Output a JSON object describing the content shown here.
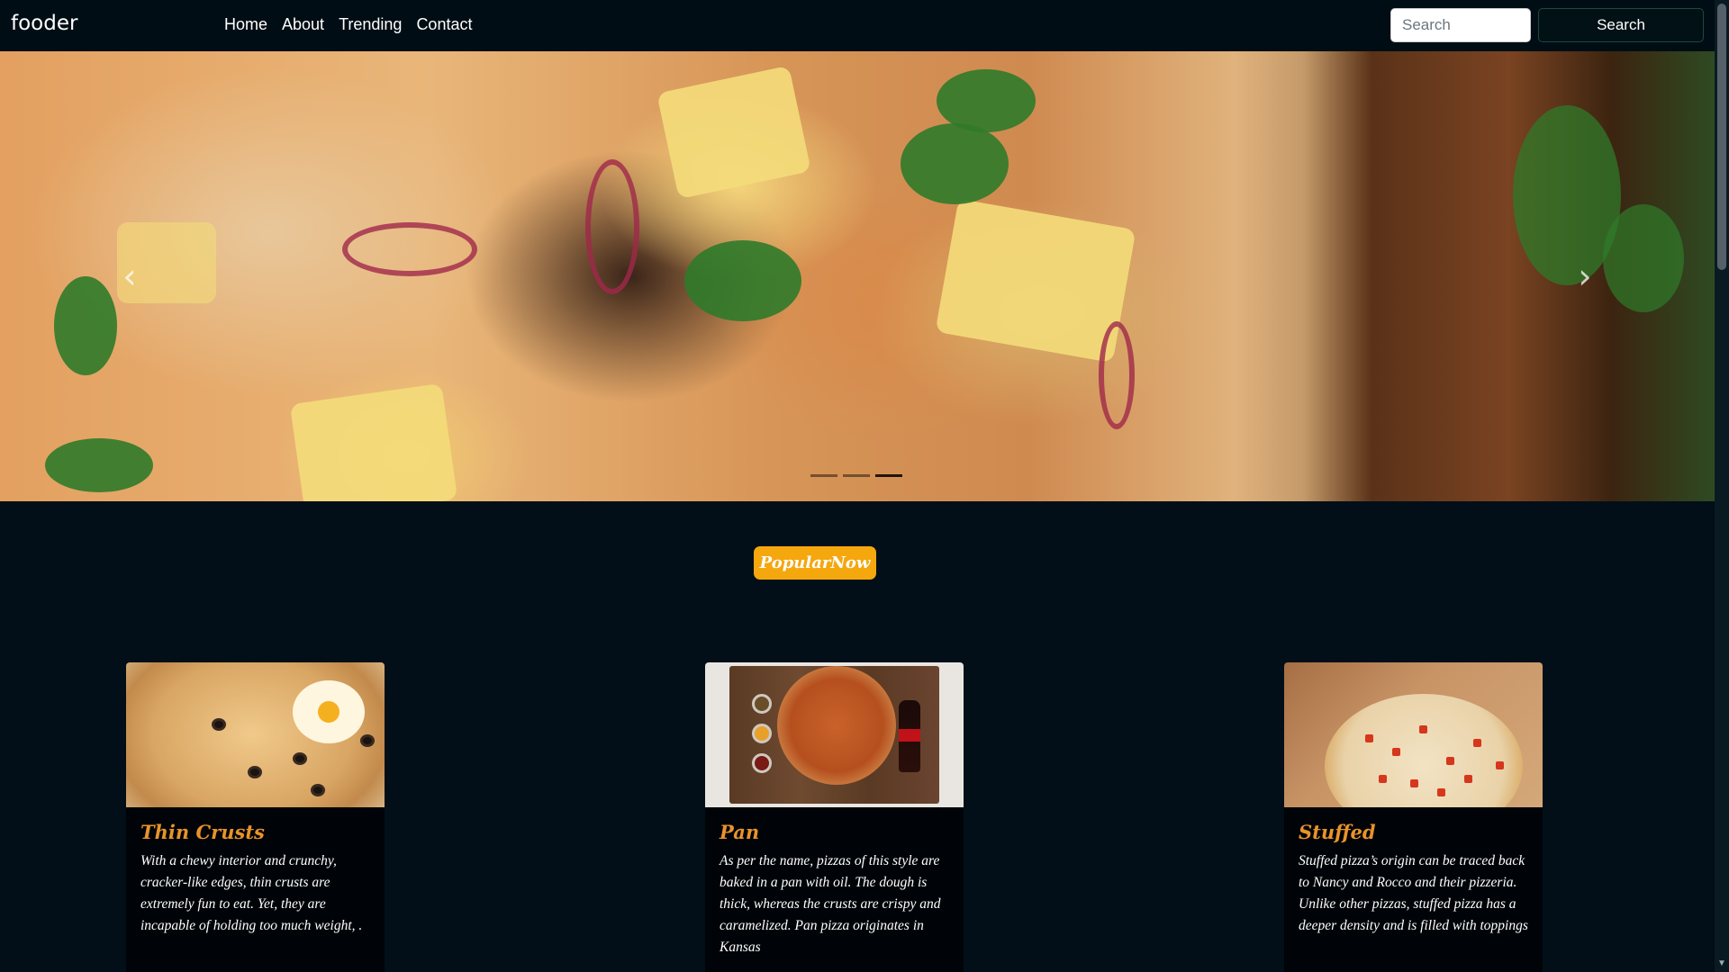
{
  "nav": {
    "brand": "fooder",
    "links": [
      "Home",
      "About",
      "Trending",
      "Contact"
    ],
    "search_placeholder": "Search",
    "search_button": "Search"
  },
  "hero": {
    "prev_icon": "chevron-left-icon",
    "next_icon": "chevron-right-icon",
    "slides": 3,
    "active_slide": 3
  },
  "popular_button": "PopularNow",
  "cards": [
    {
      "title": "Thin Crusts",
      "text": "With a chewy interior and crunchy, cracker-like edges, thin crusts are extremely fun to eat. Yet, they are incapable of holding too much weight, ."
    },
    {
      "title": "Pan",
      "text": "As per the name, pizzas of this style are baked in a pan with oil. The dough is thick, whereas the crusts are crispy and caramelized. Pan pizza originates in Kansas"
    },
    {
      "title": "Stuffed",
      "text": "Stuffed pizza’s origin can be traced back to Nancy and Rocco and their pizzeria. Unlike other pizzas, stuffed pizza has a deeper density and is filled with toppings"
    }
  ],
  "colors": {
    "background": "#020f18",
    "accent": "#f5a70e",
    "card_title": "#e8932a"
  }
}
